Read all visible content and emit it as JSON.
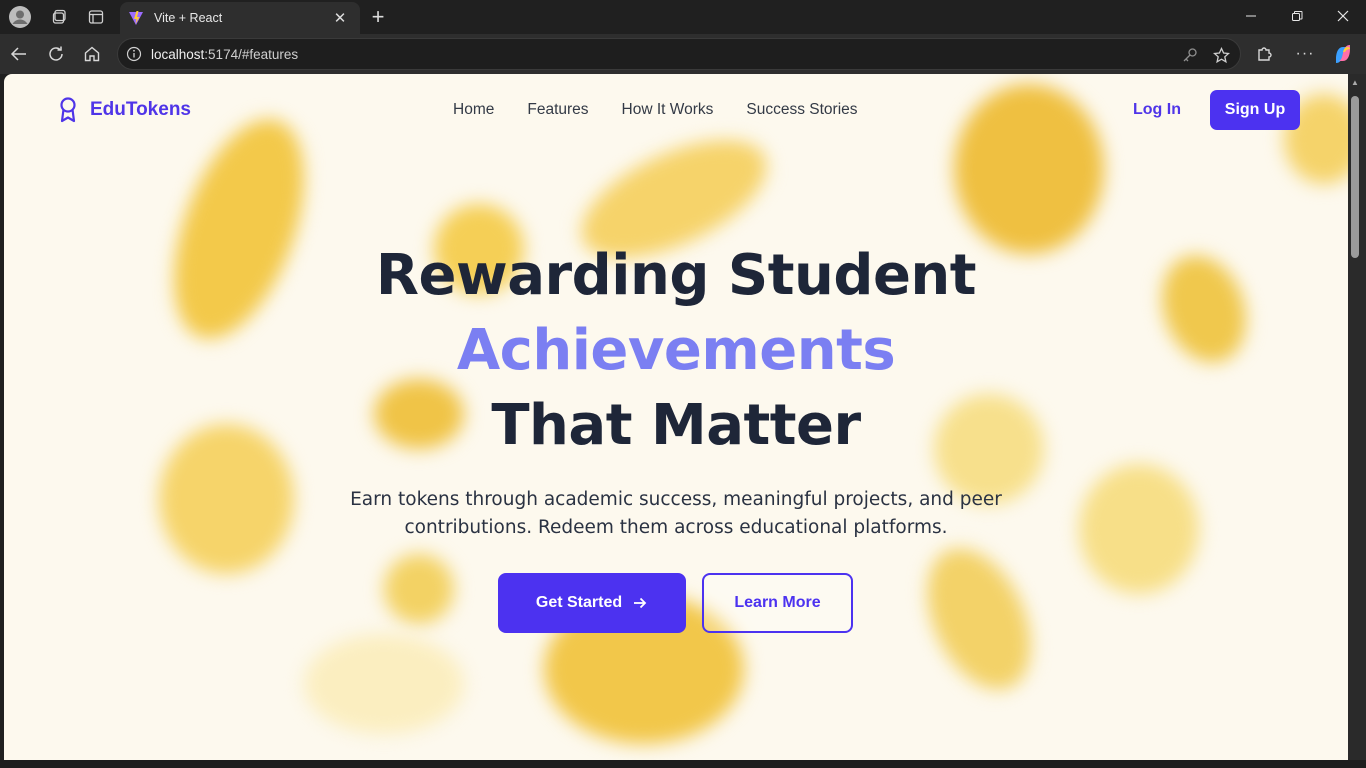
{
  "browser": {
    "tab_title": "Vite + React",
    "url_host": "localhost",
    "url_rest": ":5174/#features"
  },
  "nav": {
    "brand": "EduTokens",
    "links": [
      "Home",
      "Features",
      "How It Works",
      "Success Stories"
    ],
    "login_label": "Log In",
    "signup_label": "Sign Up"
  },
  "hero": {
    "title_line1": "Rewarding Student",
    "title_line2": "Achievements",
    "title_line3": "That Matter",
    "subtitle_line1": "Earn tokens through academic success, meaningful projects, and peer",
    "subtitle_line2": "contributions. Redeem them across educational platforms.",
    "primary_button": "Get Started",
    "secondary_button": "Learn More"
  },
  "colors": {
    "brand": "#4c32f0",
    "accent_text": "#7b7ff2",
    "heading": "#1e2638"
  },
  "icons": {
    "logo": "award-icon",
    "get_started": "arrow-right-icon"
  }
}
